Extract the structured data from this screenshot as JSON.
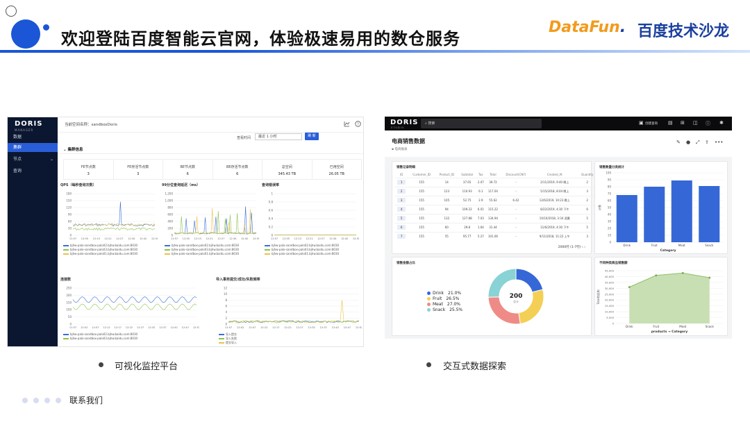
{
  "slide": {
    "title": "欢迎登陆百度智能云官网，体验极速易用的数仓服务",
    "logo_datafun_part1": "DataFun",
    "logo_datafun_part2": ".",
    "logo_baidu": "百度技术沙龙",
    "caption_left": "可视化监控平台",
    "caption_right": "交互式数据探索",
    "footer": "联系我们",
    "accent_color": "#1a56d6"
  },
  "left_screen": {
    "logo": "DORIS",
    "logo_sub": "MANAGER",
    "sidebar": [
      {
        "label": "数据",
        "active": false
      },
      {
        "label": "集群",
        "active": true
      },
      {
        "label": "节点",
        "active": false,
        "has_chevron": true
      },
      {
        "label": "查询",
        "active": false
      }
    ],
    "current_space": "当前空间名称：sandboxDoris",
    "top_icons": [
      "chart-icon",
      "help-icon"
    ],
    "time_label": "查看时间",
    "time_select": "最近 1 小时",
    "refresh_button": "刷 新",
    "cluster_header": "集群信息",
    "stats": [
      {
        "label": "FE节点数",
        "value": "3"
      },
      {
        "label": "FE存活节点数",
        "value": "3"
      },
      {
        "label": "BE节点数",
        "value": "6"
      },
      {
        "label": "BE存活节点数",
        "value": "6"
      },
      {
        "label": "总空间",
        "value": "345.43 TB"
      },
      {
        "label": "已用空间",
        "value": "26.05 TB"
      }
    ],
    "panels": [
      {
        "title": "QPS（每秒查询次数）",
        "y_ticks": [
          "180",
          "150",
          "120",
          "90",
          "60",
          "30",
          "0"
        ],
        "x_ticks": [
          "11:57",
          "12:05",
          "12:13",
          "12:21",
          "12:27",
          "12:34",
          "12:42",
          "12:50"
        ],
        "legend": [
          "bjhw-palo-sandbox-palo02.bjhw.baidu.com:8030",
          "bjhw-palo-sandbox-palo03.bjhw.baidu.com:8030",
          "bjhw-palo-sandbox-palo01.bjhw.baidu.com:8030"
        ]
      },
      {
        "title": "99分位查询延迟（ms）",
        "y_ticks": [
          "1,200",
          "1,000",
          "800",
          "600",
          "400",
          "200",
          "0"
        ],
        "x_ticks": [
          "11:57",
          "12:05",
          "12:13",
          "12:21",
          "12:27",
          "12:34",
          "12:42",
          "12:50"
        ],
        "legend": [
          "bjhw-palo-sandbox-palo02.bjhw.baidu.com:8030",
          "bjhw-palo-sandbox-palo03.bjhw.baidu.com:8030",
          "bjhw-palo-sandbox-palo01.bjhw.baidu.com:8030"
        ]
      },
      {
        "title": "查询错误率",
        "y_ticks": [
          "1",
          "0.8",
          "0.6",
          "0.4",
          "0.2",
          "0"
        ],
        "x_ticks": [
          "11:57",
          "12:05",
          "12:13",
          "12:21",
          "12:27",
          "12:34",
          "12:42",
          "12:50"
        ],
        "legend": [
          "bjhw-palo-sandbox-palo02.bjhw.baidu.com:8030",
          "bjhw-palo-sandbox-palo03.bjhw.baidu.com:8030",
          "bjhw-palo-sandbox-palo01.bjhw.baidu.com:8030"
        ]
      },
      {
        "title": "连接数",
        "y_ticks": [
          "250",
          "200",
          "150",
          "100",
          "50",
          "0"
        ],
        "x_ticks": [
          "11:57",
          "12:02",
          "12:07",
          "12:12",
          "12:17",
          "12:22",
          "12:27",
          "12:32",
          "12:37",
          "12:42",
          "12:47",
          "12:53"
        ],
        "legend": [
          "bjhw-palo-sandbox-palo02.bjhw.baidu.com:8030",
          "bjhw-palo-sandbox-palo03.bjhw.baidu.com:8030"
        ]
      },
      {
        "title": "导入事务提交/成功/失败频率",
        "y_ticks": [
          "12",
          "10",
          "8",
          "6",
          "4",
          "2",
          "0"
        ],
        "x_ticks": [
          "11:57",
          "12:02",
          "12:07",
          "12:12",
          "12:17",
          "12:22",
          "12:27",
          "12:32",
          "12:37",
          "12:42",
          "12:47",
          "12:52"
        ],
        "legend": [
          "导入提交",
          "导入失败",
          "提交导入"
        ]
      }
    ]
  },
  "right_screen": {
    "logo": "DORIS",
    "logo_sub": "STUDIO",
    "search_placeholder": "搜索",
    "new_query": "创建查询",
    "top_icons": [
      "doc-icon",
      "grid-icon",
      "chart-icon",
      "help-icon",
      "settings-icon"
    ],
    "dashboard_title": "电商销售数据",
    "dashboard_sub": "电商报表",
    "actions": [
      "edit-icon",
      "info-icon",
      "fullscreen-icon",
      "share-icon",
      "more-icon"
    ],
    "orders": {
      "title": "销售记录明细",
      "columns": [
        "ID",
        "Customer_ID",
        "Product_ID",
        "Subtotal",
        "Tax",
        "Total",
        "Discount(CNY)",
        "Created_At",
        "Quantity"
      ],
      "rows": [
        [
          "1",
          "155",
          "14",
          "37.65",
          "2.07",
          "39.72",
          "-",
          "2/11/2019, 9:40 晚上",
          "2"
        ],
        [
          "2",
          "155",
          "123",
          "110.93",
          "6.1",
          "117.04",
          "-",
          "5/15/2018, 8:04 晚上",
          "3"
        ],
        [
          "3",
          "155",
          "105",
          "52.75",
          "2.9",
          "55.62",
          "6.42",
          "12/6/2019, 10:23 晚上",
          "2"
        ],
        [
          "4",
          "155",
          "94",
          "109.22",
          "6.01",
          "115.22",
          "-",
          "8/22/2019, 4:30 下午",
          "6"
        ],
        [
          "5",
          "155",
          "132",
          "127.88",
          "7.03",
          "134.94",
          "-",
          "10/10/2018, 3:34 凌晨",
          "5"
        ],
        [
          "6",
          "155",
          "60",
          "29.8",
          "1.64",
          "31.44",
          "-",
          "11/6/2019, 4:30 下午",
          "5"
        ],
        [
          "7",
          "155",
          "55",
          "95.77",
          "5.27",
          "101.06",
          "-",
          "9/11/2018, 11:22 上午",
          "3"
        ]
      ],
      "pager": "2000行 (1-7行)"
    },
    "bar_card_title": "销售数量分类统计",
    "donut_card_title": "销售金额占比",
    "area_card_title": "不同种类商品销售额",
    "donut_total": "200",
    "donut_total_label": "总计"
  },
  "chart_data": [
    {
      "type": "bar",
      "title": "销售数量分类统计",
      "categories": [
        "Drink",
        "Fruit",
        "Meat",
        "Snack"
      ],
      "values": [
        68,
        80,
        89,
        81
      ],
      "ylabel": "计数",
      "xlabel": "Category",
      "y_ticks": [
        "100",
        "90",
        "80",
        "70",
        "60",
        "50",
        "40",
        "30",
        "20",
        "10",
        "0"
      ],
      "ylim": [
        0,
        100
      ],
      "color": "#3567d6"
    },
    {
      "type": "pie",
      "title": "销售金额占比",
      "categories": [
        "Drink",
        "Fruit",
        "Meat",
        "Snack"
      ],
      "values": [
        21.0,
        26.5,
        27.0,
        25.5
      ],
      "labels": [
        "21.0%",
        "26.5%",
        "27.0%",
        "25.5%"
      ],
      "colors": [
        "#3567d6",
        "#f4cf55",
        "#ef8b86",
        "#89d2d5"
      ]
    },
    {
      "type": "area",
      "title": "不同种类商品销售额",
      "categories": [
        "Drink",
        "Fruit",
        "Meat",
        "Snack"
      ],
      "values": [
        31000,
        41000,
        43000,
        39000
      ],
      "ylabel": "Total的总和",
      "xlabel": "products → Category",
      "y_ticks": [
        "45,000",
        "40,000",
        "35,000",
        "30,000",
        "25,000",
        "20,000",
        "15,000",
        "10,000",
        "5,000",
        "0"
      ],
      "ylim": [
        0,
        45000
      ],
      "color": "#8fbf6b"
    }
  ]
}
